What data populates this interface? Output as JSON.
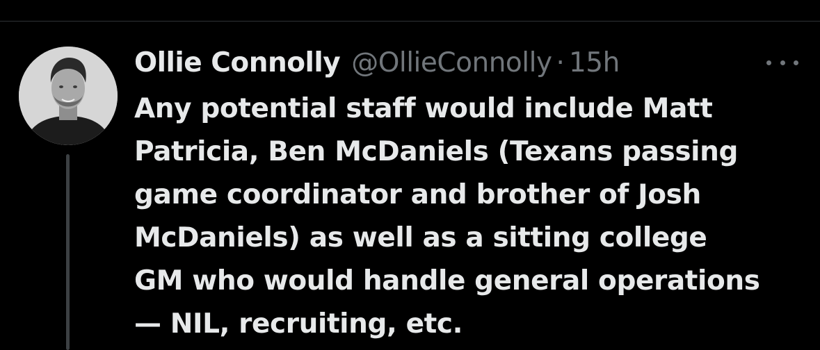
{
  "tweet": {
    "author": {
      "display_name": "Ollie Connolly",
      "handle": "@OllieConnolly",
      "avatar_icon": "profile-photo"
    },
    "separator": "·",
    "timestamp": "15h",
    "more_icon": "more-horizontal-icon",
    "text_lines": [
      "Any potential staff would include Matt",
      "Patricia, Ben McDaniels (Texans passing",
      "game coordinator and brother of Josh",
      "McDaniels) as well as a sitting college",
      "GM who would handle general operations",
      "— NIL, recruiting, etc."
    ]
  },
  "colors": {
    "background": "#000000",
    "primary_text": "#e7e9ea",
    "secondary_text": "#71767b",
    "divider": "#2f3336",
    "thread_line": "#3c4043"
  }
}
